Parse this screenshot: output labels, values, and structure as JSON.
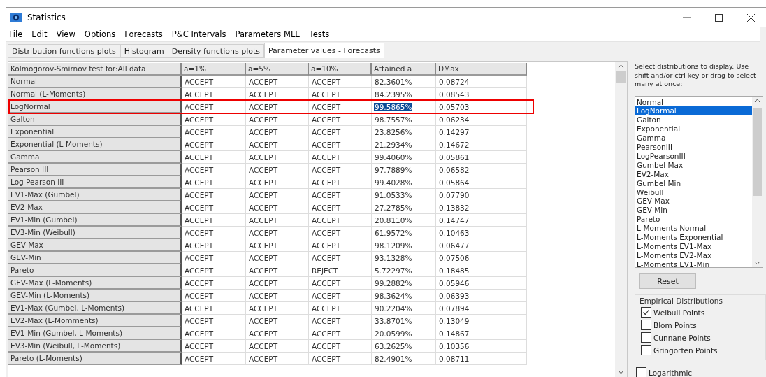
{
  "window": {
    "title": "Statistics"
  },
  "menu": [
    "File",
    "Edit",
    "View",
    "Options",
    "Forecasts",
    "P&C Intervals",
    "Parameters MLE",
    "Tests"
  ],
  "tabs": [
    {
      "label": "Distribution functions plots",
      "selected": false
    },
    {
      "label": "Histogram - Density functions plots",
      "selected": false
    },
    {
      "label": "Parameter values - Forecasts",
      "selected": true
    }
  ],
  "table": {
    "row_header_title": "Kolmogorov-Smirnov test for:All data",
    "columns": [
      "a=1%",
      "a=5%",
      "a=10%",
      "Attained a",
      "DMax"
    ],
    "rows": [
      {
        "name": "Normal",
        "cells": [
          "ACCEPT",
          "ACCEPT",
          "ACCEPT",
          "82.3601%",
          "0.08724"
        ],
        "highlighted": false,
        "selected_cell": false
      },
      {
        "name": "Normal (L-Moments)",
        "cells": [
          "ACCEPT",
          "ACCEPT",
          "ACCEPT",
          "84.2395%",
          "0.08543"
        ],
        "highlighted": false,
        "selected_cell": false
      },
      {
        "name": "LogNormal",
        "cells": [
          "ACCEPT",
          "ACCEPT",
          "ACCEPT",
          "99.5865%",
          "0.05703"
        ],
        "highlighted": true,
        "selected_cell": true
      },
      {
        "name": "Galton",
        "cells": [
          "ACCEPT",
          "ACCEPT",
          "ACCEPT",
          "98.7557%",
          "0.06234"
        ],
        "highlighted": false,
        "selected_cell": false
      },
      {
        "name": "Exponential",
        "cells": [
          "ACCEPT",
          "ACCEPT",
          "ACCEPT",
          "23.8256%",
          "0.14297"
        ],
        "highlighted": false,
        "selected_cell": false
      },
      {
        "name": "Exponential (L-Moments)",
        "cells": [
          "ACCEPT",
          "ACCEPT",
          "ACCEPT",
          "21.2934%",
          "0.14672"
        ],
        "highlighted": false,
        "selected_cell": false
      },
      {
        "name": "Gamma",
        "cells": [
          "ACCEPT",
          "ACCEPT",
          "ACCEPT",
          "99.4060%",
          "0.05861"
        ],
        "highlighted": false,
        "selected_cell": false
      },
      {
        "name": "Pearson III",
        "cells": [
          "ACCEPT",
          "ACCEPT",
          "ACCEPT",
          "97.7889%",
          "0.06582"
        ],
        "highlighted": false,
        "selected_cell": false
      },
      {
        "name": "Log Pearson III",
        "cells": [
          "ACCEPT",
          "ACCEPT",
          "ACCEPT",
          "99.4028%",
          "0.05864"
        ],
        "highlighted": false,
        "selected_cell": false
      },
      {
        "name": "EV1-Max (Gumbel)",
        "cells": [
          "ACCEPT",
          "ACCEPT",
          "ACCEPT",
          "91.0533%",
          "0.07790"
        ],
        "highlighted": false,
        "selected_cell": false
      },
      {
        "name": "EV2-Max",
        "cells": [
          "ACCEPT",
          "ACCEPT",
          "ACCEPT",
          "27.2785%",
          "0.13832"
        ],
        "highlighted": false,
        "selected_cell": false
      },
      {
        "name": "EV1-Min (Gumbel)",
        "cells": [
          "ACCEPT",
          "ACCEPT",
          "ACCEPT",
          "20.8110%",
          "0.14747"
        ],
        "highlighted": false,
        "selected_cell": false
      },
      {
        "name": "EV3-Min (Weibull)",
        "cells": [
          "ACCEPT",
          "ACCEPT",
          "ACCEPT",
          "61.9572%",
          "0.10463"
        ],
        "highlighted": false,
        "selected_cell": false
      },
      {
        "name": "GEV-Max",
        "cells": [
          "ACCEPT",
          "ACCEPT",
          "ACCEPT",
          "98.1209%",
          "0.06477"
        ],
        "highlighted": false,
        "selected_cell": false
      },
      {
        "name": "GEV-Min",
        "cells": [
          "ACCEPT",
          "ACCEPT",
          "ACCEPT",
          "93.1328%",
          "0.07506"
        ],
        "highlighted": false,
        "selected_cell": false
      },
      {
        "name": "Pareto",
        "cells": [
          "ACCEPT",
          "ACCEPT",
          "REJECT",
          "5.72297%",
          "0.18485"
        ],
        "highlighted": false,
        "selected_cell": false
      },
      {
        "name": "GEV-Max (L-Moments)",
        "cells": [
          "ACCEPT",
          "ACCEPT",
          "ACCEPT",
          "99.2882%",
          "0.05946"
        ],
        "highlighted": false,
        "selected_cell": false
      },
      {
        "name": "GEV-Min (L-Moments)",
        "cells": [
          "ACCEPT",
          "ACCEPT",
          "ACCEPT",
          "98.3624%",
          "0.06393"
        ],
        "highlighted": false,
        "selected_cell": false
      },
      {
        "name": "EV1-Max (Gumbel, L-Moments)",
        "cells": [
          "ACCEPT",
          "ACCEPT",
          "ACCEPT",
          "90.2204%",
          "0.07894"
        ],
        "highlighted": false,
        "selected_cell": false
      },
      {
        "name": "EV2-Max (L-Momments)",
        "cells": [
          "ACCEPT",
          "ACCEPT",
          "ACCEPT",
          "33.8701%",
          "0.13049"
        ],
        "highlighted": false,
        "selected_cell": false
      },
      {
        "name": "EV1-Min (Gumbel, L-Moments)",
        "cells": [
          "ACCEPT",
          "ACCEPT",
          "ACCEPT",
          "20.0599%",
          "0.14867"
        ],
        "highlighted": false,
        "selected_cell": false
      },
      {
        "name": "EV3-Min (Weibull, L-Moments)",
        "cells": [
          "ACCEPT",
          "ACCEPT",
          "ACCEPT",
          "63.2625%",
          "0.10356"
        ],
        "highlighted": false,
        "selected_cell": false
      },
      {
        "name": "Pareto (L-Moments)",
        "cells": [
          "ACCEPT",
          "ACCEPT",
          "ACCEPT",
          "82.4901%",
          "0.08711"
        ],
        "highlighted": false,
        "selected_cell": false
      }
    ]
  },
  "side_panel": {
    "instructions": "Select distributions to display. Use shift and/or ctrl key or drag to select many at once:",
    "distributions": [
      {
        "label": "Normal",
        "selected": false
      },
      {
        "label": "LogNormal",
        "selected": true
      },
      {
        "label": "Galton",
        "selected": false
      },
      {
        "label": "Exponential",
        "selected": false
      },
      {
        "label": "Gamma",
        "selected": false
      },
      {
        "label": "PearsonIII",
        "selected": false
      },
      {
        "label": "LogPearsonIII",
        "selected": false
      },
      {
        "label": "Gumbel Max",
        "selected": false
      },
      {
        "label": "EV2-Max",
        "selected": false
      },
      {
        "label": "Gumbel Min",
        "selected": false
      },
      {
        "label": "Weibull",
        "selected": false
      },
      {
        "label": "GEV Max",
        "selected": false
      },
      {
        "label": "GEV Min",
        "selected": false
      },
      {
        "label": "Pareto",
        "selected": false
      },
      {
        "label": "L-Moments Normal",
        "selected": false
      },
      {
        "label": "L-Moments Exponential",
        "selected": false
      },
      {
        "label": "L-Moments EV1-Max",
        "selected": false
      },
      {
        "label": "L-Moments EV2-Max",
        "selected": false
      },
      {
        "label": "L-Moments EV1-Min",
        "selected": false
      }
    ],
    "reset_button": "Reset",
    "empirical": {
      "title": "Empirical Distributions",
      "options": [
        {
          "label": "Weibull Points",
          "checked": true
        },
        {
          "label": "Blom Points",
          "checked": false
        },
        {
          "label": "Cunnane Points",
          "checked": false
        },
        {
          "label": "Gringorten Points",
          "checked": false
        }
      ]
    },
    "logarithmic": {
      "label": "Logarithmic",
      "checked": false
    }
  }
}
